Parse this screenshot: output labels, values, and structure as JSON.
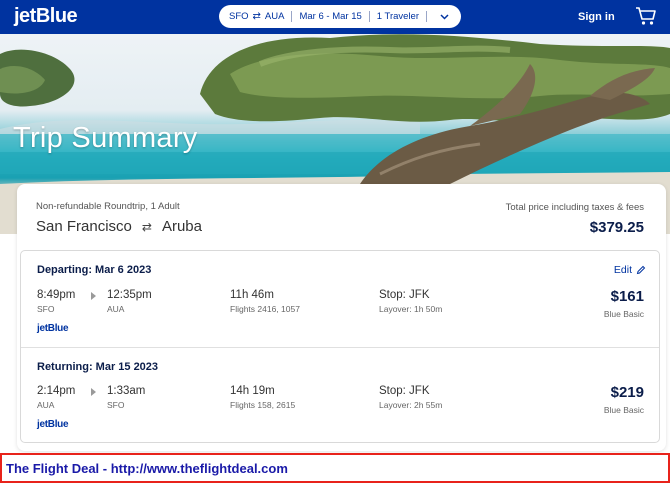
{
  "header": {
    "logo": "jetBlue",
    "search": {
      "origin": "SFO",
      "destination": "AUA",
      "swap_icon": "⇄",
      "dates": "Mar 6 - Mar 15",
      "travelers": "1 Traveler"
    },
    "signin_label": "Sign in",
    "cart_icon": "cart-icon"
  },
  "hero": {
    "title": "Trip Summary"
  },
  "summary": {
    "fare_type": "Non-refundable Roundtrip, 1 Adult",
    "origin_city": "San Francisco",
    "swap_icon": "⇄",
    "destination_city": "Aruba",
    "total_label": "Total price including taxes & fees",
    "total_amount": "$379.25"
  },
  "departing": {
    "title": "Departing: Mar 6 2023",
    "edit_label": "Edit",
    "depart_time": "8:49pm",
    "depart_airport": "SFO",
    "arrive_time": "12:35pm",
    "arrive_airport": "AUA",
    "duration": "11h 46m",
    "flights": "Flights 2416, 1057",
    "stop": "Stop: JFK",
    "layover": "Layover: 1h 50m",
    "price": "$161",
    "fare": "Blue Basic",
    "carrier": "jetBlue"
  },
  "returning": {
    "title": "Returning: Mar 15 2023",
    "depart_time": "2:14pm",
    "depart_airport": "AUA",
    "arrive_time": "1:33am",
    "arrive_airport": "SFO",
    "duration": "14h 19m",
    "flights": "Flights 158, 2615",
    "stop": "Stop: JFK",
    "layover": "Layover: 2h 55m",
    "price": "$219",
    "fare": "Blue Basic",
    "carrier": "jetBlue"
  },
  "banner": {
    "text": "The Flight Deal - http://www.theflightdeal.com"
  },
  "colors": {
    "brand_blue": "#0033a0",
    "banner_border": "#e8231b",
    "banner_text": "#1a1aa8"
  }
}
